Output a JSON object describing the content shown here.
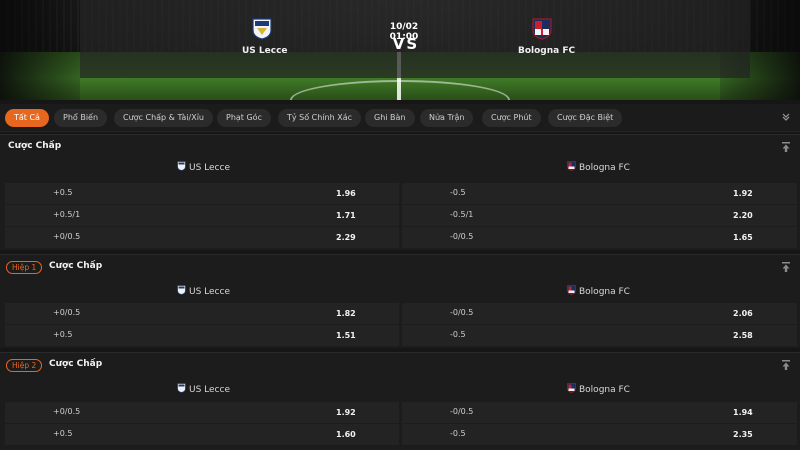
{
  "match": {
    "time": "10/02 01:00",
    "vs": "VS",
    "home": "US Lecce",
    "away": "Bologna FC"
  },
  "tabs": [
    {
      "label": "Tất Cả",
      "active": true
    },
    {
      "label": "Phổ Biến"
    },
    {
      "label": "Cược Chấp & Tài/Xỉu"
    },
    {
      "label": "Phạt Góc"
    },
    {
      "label": "Tỷ Số Chính Xác"
    },
    {
      "label": "Ghi Bàn"
    },
    {
      "label": "Nửa Trận"
    },
    {
      "label": "Cược Phút"
    },
    {
      "label": "Cược Đặc Biệt"
    }
  ],
  "sections": [
    {
      "badge": "",
      "title": "Cược Chấp",
      "home": "US Lecce",
      "away": "Bologna FC",
      "rows": [
        {
          "home_line": "+0.5",
          "home_price": "1.96",
          "away_line": "-0.5",
          "away_price": "1.92"
        },
        {
          "home_line": "+0.5/1",
          "home_price": "1.71",
          "away_line": "-0.5/1",
          "away_price": "2.20"
        },
        {
          "home_line": "+0/0.5",
          "home_price": "2.29",
          "away_line": "-0/0.5",
          "away_price": "1.65"
        }
      ]
    },
    {
      "badge": "Hiệp 1",
      "title": "Cược Chấp",
      "home": "US Lecce",
      "away": "Bologna FC",
      "rows": [
        {
          "home_line": "+0/0.5",
          "home_price": "1.82",
          "away_line": "-0/0.5",
          "away_price": "2.06"
        },
        {
          "home_line": "+0.5",
          "home_price": "1.51",
          "away_line": "-0.5",
          "away_price": "2.58"
        }
      ]
    },
    {
      "badge": "Hiệp 2",
      "title": "Cược Chấp",
      "home": "US Lecce",
      "away": "Bologna FC",
      "rows": [
        {
          "home_line": "+0/0.5",
          "home_price": "1.92",
          "away_line": "-0/0.5",
          "away_price": "1.94"
        },
        {
          "home_line": "+0.5",
          "home_price": "1.60",
          "away_line": "-0.5",
          "away_price": "2.35"
        }
      ]
    }
  ],
  "colors": {
    "accent": "#e8671e",
    "background": "#161616",
    "cell": "#232323"
  },
  "icons": {
    "home_crest": "lecce-crest-icon",
    "away_crest": "bologna-crest-icon",
    "pin": "pin-to-top-icon",
    "collapse": "double-chevron-down-icon"
  }
}
